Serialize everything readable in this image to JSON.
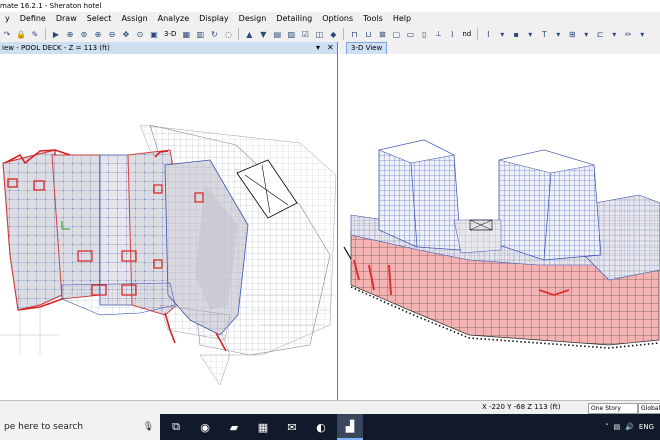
{
  "window": {
    "title": "mate 16.2.1 - Sheraton hotel"
  },
  "menu": [
    "y",
    "Define",
    "Draw",
    "Select",
    "Assign",
    "Analyze",
    "Display",
    "Design",
    "Detailing",
    "Options",
    "Tools",
    "Help"
  ],
  "toolbar": {
    "view_3d_label": "3-D",
    "nd_label": "nd"
  },
  "left_pane": {
    "title": "iew - POOL DECK - Z = 113 (ft)",
    "pin": "▾",
    "close": "✕"
  },
  "right_pane": {
    "tab_label": "3-D View"
  },
  "status": {
    "coords": "X -220  Y -68  Z 113 (ft)",
    "story_combo": "One Story",
    "coord_combo": "Global"
  },
  "taskbar": {
    "search_text": "pe here to search",
    "language": "ENG"
  },
  "colors": {
    "frame_blue": "#3850b0",
    "wall_red": "#e03030",
    "slab_grey": "#9a9aa4",
    "panel_red": "#f3b3b3"
  }
}
